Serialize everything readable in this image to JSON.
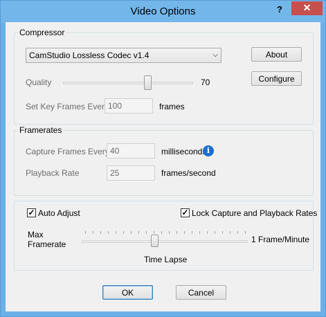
{
  "window": {
    "title": "Video Options",
    "help_label": "?",
    "close_label": "✕"
  },
  "compressor": {
    "group_label": "Compressor",
    "codec": "CamStudio Lossless Codec v1.4",
    "about_label": "About",
    "configure_label": "Configure",
    "quality_label": "Quality",
    "quality_value": "70",
    "quality_level": 0.7,
    "keyframes_label": "Set Key Frames Every",
    "keyframes_value": "100",
    "keyframes_unit": "frames"
  },
  "framerates": {
    "group_label": "Framerates",
    "capture_label": "Capture Frames Every",
    "capture_value": "40",
    "capture_unit": "milliseconds",
    "playback_label": "Playback Rate",
    "playback_value": "25",
    "playback_unit": "frames/second"
  },
  "adjust": {
    "auto_adjust_label": "Auto Adjust",
    "auto_adjust_checked": true,
    "lock_label": "Lock Capture and Playback Rates",
    "lock_checked": true,
    "max_label": "Max",
    "framerate_label": "Framerate",
    "right_label": "1 Frame/Minute",
    "bottom_label": "Time Lapse",
    "slider_level": 0.45
  },
  "footer": {
    "ok_label": "OK",
    "cancel_label": "Cancel"
  },
  "colors": {
    "titlebar": "#73b6ea",
    "close_button": "#c7504c",
    "info_icon": "#1e6fcf"
  }
}
